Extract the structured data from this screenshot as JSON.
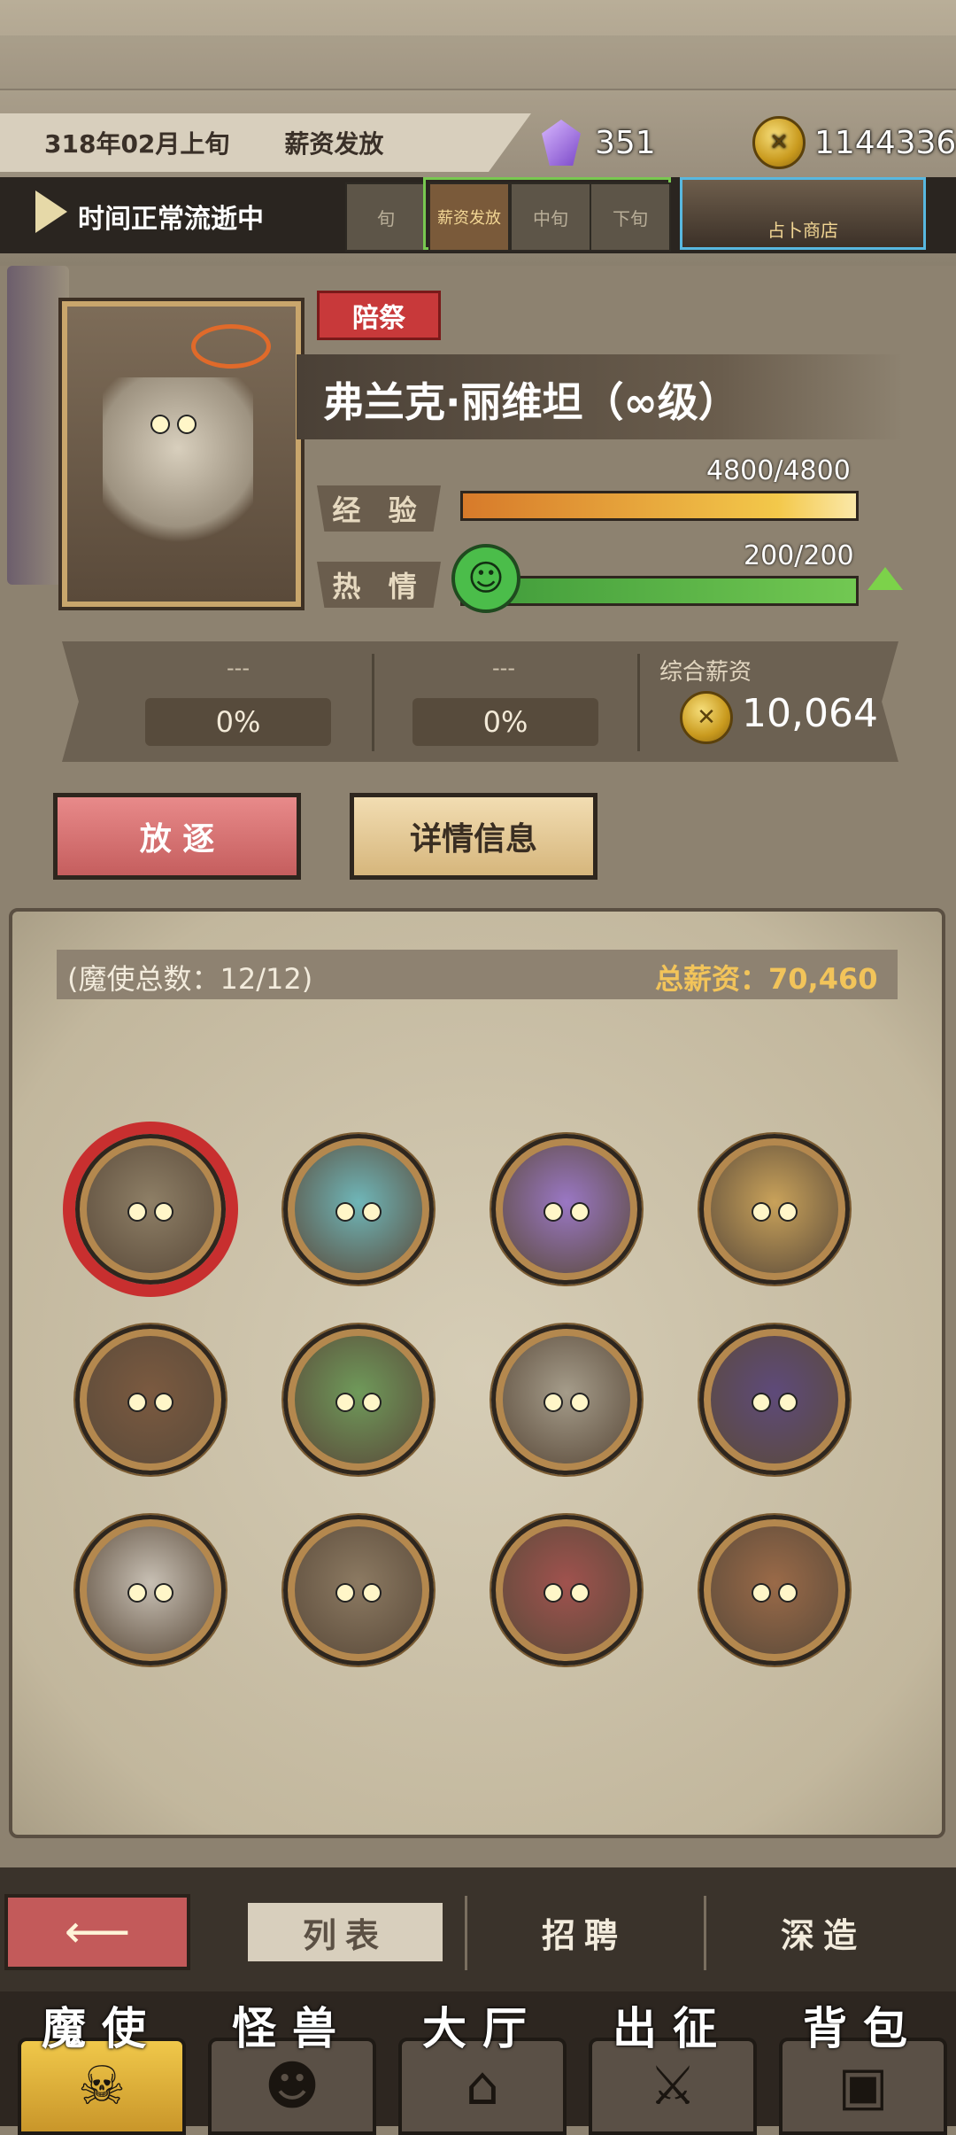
{
  "header": {
    "date": "318年02月上旬",
    "event": "薪资发放",
    "crystals": "351",
    "coins": "1144336",
    "time_status": "时间正常流逝中",
    "phases": [
      "旬",
      "薪资发放",
      "中旬",
      "下旬"
    ],
    "shop_label": "占卜商店"
  },
  "character": {
    "role": "陪祭",
    "name": "弗兰克·丽维坦（∞级）",
    "exp_label": "经 验",
    "exp_value": "4800/4800",
    "exp_fraction": 1.0,
    "passion_label": "热 情",
    "passion_value": "200/200",
    "passion_fraction": 1.0,
    "slots": [
      {
        "dash": "---",
        "pct": "0%"
      },
      {
        "dash": "---",
        "pct": "0%"
      }
    ],
    "salary_label": "综合薪资",
    "salary_value": "10,064",
    "exile_button": "放 逐",
    "detail_button": "详情信息"
  },
  "roster": {
    "count_text": "(魔使总数：12/12)",
    "total_salary": "总薪资：70,460",
    "members": [
      {
        "name": "avatar-1",
        "color": "#8e7f66",
        "selected": true
      },
      {
        "name": "avatar-2",
        "color": "#6fb6b8",
        "selected": false
      },
      {
        "name": "avatar-3",
        "color": "#9a77c4",
        "selected": false
      },
      {
        "name": "avatar-4",
        "color": "#c9a25a",
        "selected": false
      },
      {
        "name": "avatar-5",
        "color": "#7b5a40",
        "selected": false
      },
      {
        "name": "avatar-6",
        "color": "#6f9a5a",
        "selected": false
      },
      {
        "name": "avatar-7",
        "color": "#a59c8a",
        "selected": false
      },
      {
        "name": "avatar-8",
        "color": "#5e4a7a",
        "selected": false
      },
      {
        "name": "avatar-9",
        "color": "#c8c0b4",
        "selected": false
      },
      {
        "name": "avatar-10",
        "color": "#8c7a62",
        "selected": false
      },
      {
        "name": "avatar-11",
        "color": "#a0524e",
        "selected": false
      },
      {
        "name": "avatar-12",
        "color": "#9a6a48",
        "selected": false
      }
    ]
  },
  "subtabs": {
    "back_icon": "arrow-left-icon",
    "list": "列表",
    "recruit": "招聘",
    "forge": "深造"
  },
  "nav": [
    "魔使",
    "怪兽",
    "大厅",
    "出征",
    "背包"
  ]
}
